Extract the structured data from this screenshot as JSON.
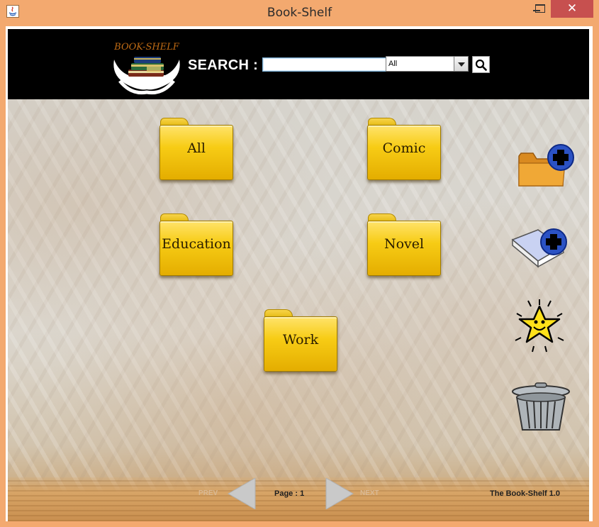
{
  "window": {
    "title": "Book-Shelf",
    "close_glyph": "✕"
  },
  "header": {
    "logo_text": "BOOK-SHELF",
    "search_label": "SEARCH :",
    "search_value": "",
    "category_selected": "All"
  },
  "folders": [
    {
      "label": "All"
    },
    {
      "label": "Comic"
    },
    {
      "label": "Education"
    },
    {
      "label": "Novel"
    },
    {
      "label": "Work"
    }
  ],
  "side_actions": [
    {
      "icon": "add-folder-icon"
    },
    {
      "icon": "add-book-icon"
    },
    {
      "icon": "favorites-star-icon"
    },
    {
      "icon": "trash-can-icon"
    }
  ],
  "footer": {
    "prev_label": "PREV",
    "next_label": "NEXT",
    "page_text": "Page : 1",
    "version": "The Book-Shelf 1.0"
  },
  "colors": {
    "titlebar": "#f3a96f",
    "close_button": "#c7504f",
    "header_bg": "#000000",
    "folder_yellow": "#f7cc15"
  }
}
